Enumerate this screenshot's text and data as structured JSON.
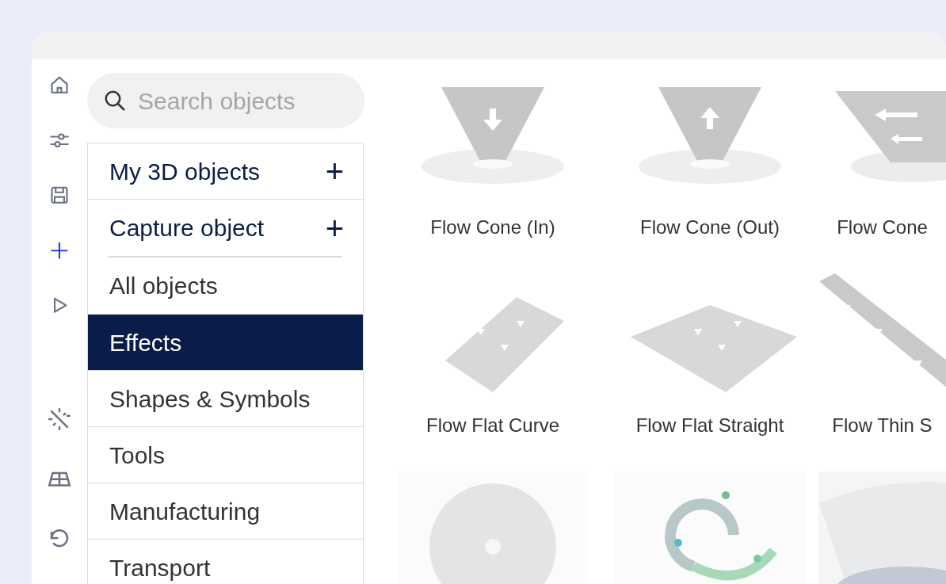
{
  "rail_top": [
    {
      "selected": false
    },
    {
      "selected": false
    },
    {
      "selected": false
    },
    {
      "selected": true
    },
    {
      "selected": false
    }
  ],
  "rail_bottom": [
    {
      "selected": false
    },
    {
      "selected": false
    },
    {
      "selected": false
    }
  ],
  "search": {
    "placeholder": "Search objects"
  },
  "actions": [
    {
      "label": "My 3D objects",
      "icon": "+"
    },
    {
      "label": "Capture object",
      "icon": "+"
    }
  ],
  "categories": [
    {
      "label": "All objects",
      "selected": false
    },
    {
      "label": "Effects",
      "selected": true
    },
    {
      "label": "Shapes & Symbols",
      "selected": false
    },
    {
      "label": "Tools",
      "selected": false
    },
    {
      "label": "Manufacturing",
      "selected": false
    },
    {
      "label": "Transport",
      "selected": false
    }
  ],
  "objects": [
    {
      "kind": "picture",
      "label": "Flow Cone (In)"
    },
    {
      "kind": "picture",
      "label": "Flow Cone (Out)"
    },
    {
      "kind": "picture",
      "label": "Flow Cone"
    },
    {
      "kind": "picture",
      "label": "Flow Flat Curve"
    },
    {
      "kind": "picture",
      "label": "Flow Flat Straight"
    },
    {
      "kind": "picture",
      "label": "Flow Thin S"
    },
    {
      "kind": "picture"
    },
    {
      "kind": "picture"
    },
    {
      "kind": "picture"
    }
  ]
}
